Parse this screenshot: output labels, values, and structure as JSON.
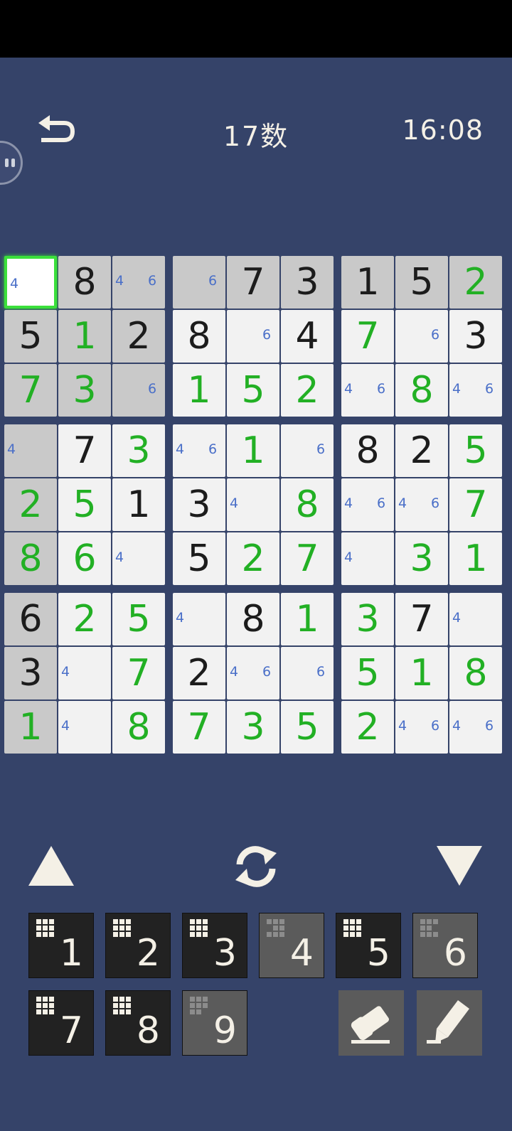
{
  "header": {
    "title": "17数",
    "timer": "16:08"
  },
  "board": {
    "rows": [
      [
        "",
        "8",
        "",
        "",
        "7",
        "3",
        "1",
        "5",
        "2"
      ],
      [
        "5",
        "1",
        "2",
        "8",
        "",
        "4",
        "7",
        "",
        "3"
      ],
      [
        "7",
        "3",
        "",
        "1",
        "5",
        "2",
        "",
        "8",
        ""
      ],
      [
        "",
        "7",
        "3",
        "",
        "1",
        "",
        "8",
        "2",
        "5"
      ],
      [
        "2",
        "5",
        "1",
        "3",
        "",
        "8",
        "",
        "",
        "7"
      ],
      [
        "8",
        "6",
        "",
        "5",
        "2",
        "7",
        "",
        "3",
        "1"
      ],
      [
        "6",
        "2",
        "5",
        "",
        "8",
        "1",
        "3",
        "7",
        ""
      ],
      [
        "3",
        "",
        "7",
        "2",
        "",
        "",
        "5",
        "1",
        "8"
      ],
      [
        "1",
        "",
        "8",
        "7",
        "3",
        "5",
        "2",
        "",
        ""
      ]
    ],
    "given_mask": [
      "011111110",
      "101101011",
      "000000000",
      "010000110",
      "001100000",
      "000100000",
      "100010010",
      "100100000",
      "000000000"
    ],
    "pencil_marks": {
      "0,0": [
        "4"
      ],
      "0,2": [
        "4",
        "6"
      ],
      "0,3": [
        "6"
      ],
      "1,4": [
        "6"
      ],
      "1,7": [
        "6"
      ],
      "2,2": [
        "6"
      ],
      "2,6": [
        "4",
        "6"
      ],
      "2,8": [
        "4",
        "6"
      ],
      "3,0": [
        "4"
      ],
      "3,3": [
        "4",
        "6"
      ],
      "3,5": [
        "6"
      ],
      "4,4": [
        "4"
      ],
      "4,6": [
        "4",
        "6"
      ],
      "4,7": [
        "4",
        "6"
      ],
      "5,2": [
        "4"
      ],
      "5,6": [
        "4"
      ],
      "6,3": [
        "4"
      ],
      "6,8": [
        "4"
      ],
      "7,1": [
        "4"
      ],
      "7,4": [
        "4",
        "6"
      ],
      "7,5": [
        "6"
      ],
      "8,1": [
        "4"
      ],
      "8,7": [
        "4",
        "6"
      ],
      "8,8": [
        "4",
        "6"
      ]
    },
    "selected_cell": [
      0,
      0
    ],
    "highlighted_cells": [
      "0,1",
      "0,2",
      "0,3",
      "0,4",
      "0,5",
      "0,6",
      "0,7",
      "0,8",
      "1,0",
      "1,1",
      "1,2",
      "2,0",
      "2,1",
      "2,2",
      "3,0",
      "4,0",
      "5,0",
      "6,0",
      "7,0",
      "8,0"
    ]
  },
  "controls": {
    "keys": [
      {
        "label": "1",
        "state": "active"
      },
      {
        "label": "2",
        "state": "active"
      },
      {
        "label": "3",
        "state": "active"
      },
      {
        "label": "4",
        "state": "dim"
      },
      {
        "label": "5",
        "state": "active"
      },
      {
        "label": "6",
        "state": "dim"
      },
      {
        "label": "7",
        "state": "active"
      },
      {
        "label": "8",
        "state": "active"
      },
      {
        "label": "9",
        "state": "dim"
      }
    ],
    "icons": {
      "back": "undo-arrow-icon",
      "up": "triangle-up-icon",
      "down": "triangle-down-icon",
      "refresh": "refresh-icon",
      "eraser": "eraser-icon",
      "pencil": "pencil-icon"
    }
  },
  "colors": {
    "background": "#354369",
    "given_digit": "#1c1c1c",
    "user_digit": "#22b024",
    "pencil_mark": "#4a6fc8",
    "selection": "#3be03b"
  }
}
